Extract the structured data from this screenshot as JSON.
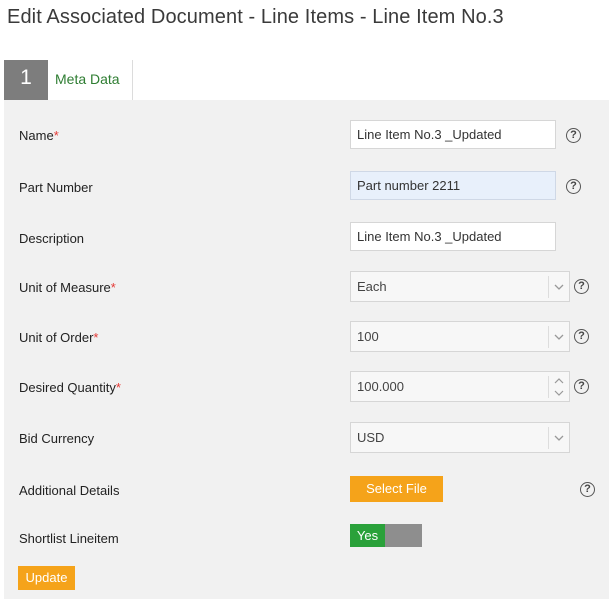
{
  "page": {
    "title": "Edit Associated Document - Line Items - Line Item No.3"
  },
  "tabs": {
    "step_number": "1",
    "meta_label": "Meta Data"
  },
  "required_mark": "*",
  "help_glyph": "?",
  "fields": {
    "name": {
      "label": "Name",
      "value": "Line Item No.3 _Updated"
    },
    "part_number": {
      "label": "Part Number",
      "value": "Part number 2211"
    },
    "description": {
      "label": "Description",
      "value": "Line Item No.3 _Updated"
    },
    "unit_of_measure": {
      "label": "Unit of Measure",
      "value": "Each"
    },
    "unit_of_order": {
      "label": "Unit of Order",
      "value": "100"
    },
    "desired_quantity": {
      "label": "Desired Quantity",
      "value": "100.000"
    },
    "bid_currency": {
      "label": "Bid Currency",
      "value": "USD"
    },
    "additional_details": {
      "label": "Additional Details",
      "button": "Select File"
    },
    "shortlist": {
      "label": "Shortlist Lineitem",
      "toggle_on": "Yes"
    }
  },
  "actions": {
    "update": "Update"
  },
  "colors": {
    "accent_orange": "#f5a31a",
    "toggle_green": "#2aa13a",
    "tab_green": "#2e7d32",
    "required_red": "#e53935"
  },
  "icons": {
    "help": "help-circle-icon",
    "dropdown": "chevron-down-icon",
    "spinner": "spinner-arrows-icon"
  }
}
